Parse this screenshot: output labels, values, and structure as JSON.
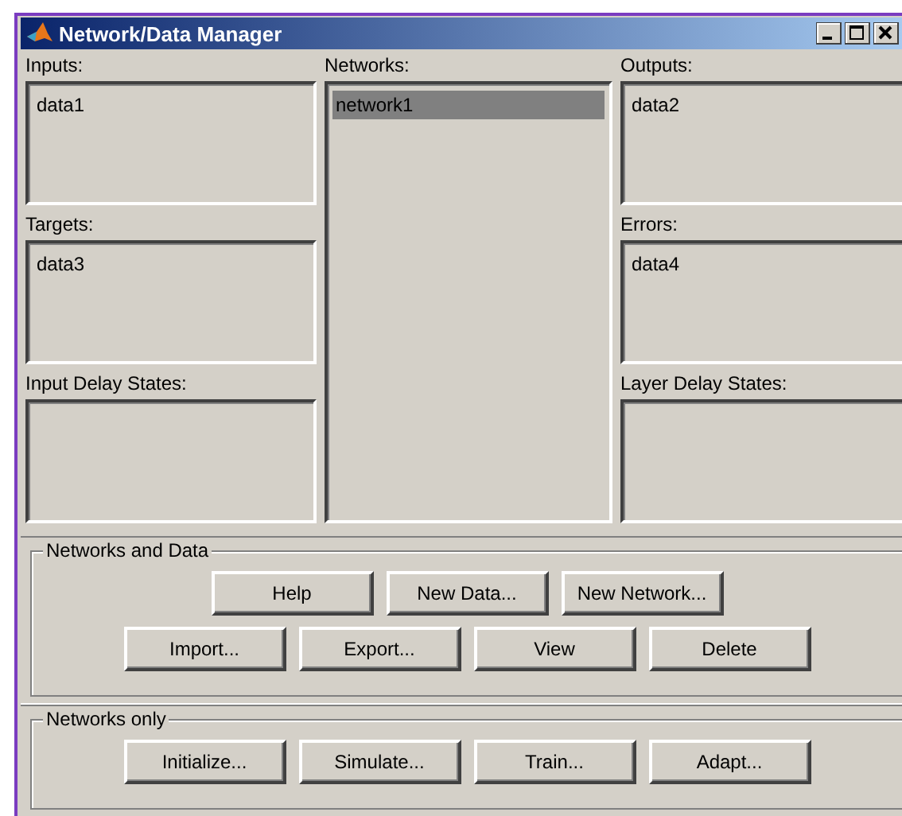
{
  "window": {
    "title": "Network/Data Manager"
  },
  "columns": [
    [
      {
        "label": "Inputs:",
        "items": [
          {
            "text": "data1",
            "selected": false
          }
        ]
      },
      {
        "label": "Targets:",
        "items": [
          {
            "text": "data3",
            "selected": false
          }
        ]
      },
      {
        "label": "Input Delay States:"
      }
    ],
    [
      {
        "label": "Networks:",
        "items": [
          {
            "text": "network1",
            "selected": true
          }
        ]
      }
    ],
    [
      {
        "label": "Outputs:",
        "items": [
          {
            "text": "data2",
            "selected": false
          }
        ]
      },
      {
        "label": "Errors:",
        "items": [
          {
            "text": "data4",
            "selected": false
          }
        ]
      },
      {
        "label": "Layer Delay States:"
      }
    ]
  ],
  "groups": [
    {
      "title": "Networks and Data",
      "rows": [
        [
          "Help",
          "New Data...",
          "New Network..."
        ],
        [
          "Import...",
          "Export...",
          "View",
          "Delete"
        ]
      ]
    },
    {
      "title": "Networks only",
      "rows": [
        [
          "Initialize...",
          "Simulate...",
          "Train...",
          "Adapt..."
        ]
      ]
    }
  ]
}
